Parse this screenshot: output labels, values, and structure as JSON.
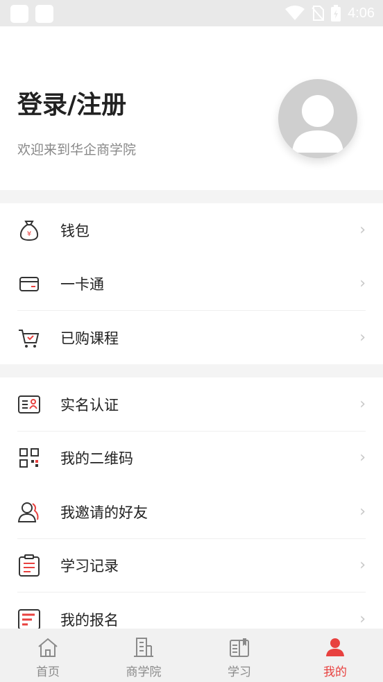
{
  "status_bar": {
    "time": "4:06"
  },
  "header": {
    "login_title": "登录/注册",
    "welcome": "欢迎来到华企商学院"
  },
  "menu_group_1": [
    {
      "label": "钱包",
      "icon": "wallet-icon"
    },
    {
      "label": "一卡通",
      "icon": "card-icon"
    },
    {
      "label": "已购课程",
      "icon": "cart-icon"
    }
  ],
  "menu_group_2": [
    {
      "label": "实名认证",
      "icon": "id-card-icon"
    },
    {
      "label": "我的二维码",
      "icon": "qrcode-icon"
    },
    {
      "label": "我邀请的好友",
      "icon": "friends-icon"
    },
    {
      "label": "学习记录",
      "icon": "clipboard-icon"
    },
    {
      "label": "我的报名",
      "icon": "form-icon"
    }
  ],
  "tabs": [
    {
      "label": "首页",
      "icon": "home-icon",
      "active": false
    },
    {
      "label": "商学院",
      "icon": "building-icon",
      "active": false
    },
    {
      "label": "学习",
      "icon": "book-icon",
      "active": false
    },
    {
      "label": "我的",
      "icon": "user-icon",
      "active": true
    }
  ],
  "colors": {
    "accent": "#e8413f",
    "inactive": "#8a8a8a"
  }
}
